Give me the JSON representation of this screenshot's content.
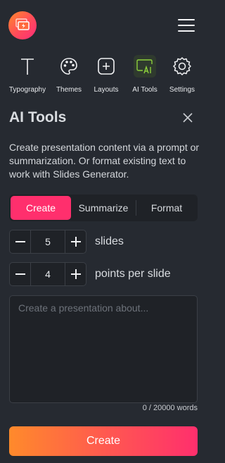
{
  "header": {
    "logo_icon": "slides-logo-icon",
    "menu_icon": "hamburger-menu-icon"
  },
  "tools": [
    {
      "label": "Typography",
      "icon": "text-t-icon"
    },
    {
      "label": "Themes",
      "icon": "palette-icon"
    },
    {
      "label": "Layouts",
      "icon": "add-square-icon"
    },
    {
      "label": "AI Tools",
      "icon": "ai-icon",
      "active": true
    },
    {
      "label": "Settings",
      "icon": "gear-icon"
    }
  ],
  "panel": {
    "title": "AI Tools",
    "description": "Create presentation content via a prompt or summarization. Or format existing text to work with Slides Generator.",
    "tabs": [
      {
        "label": "Create",
        "active": true
      },
      {
        "label": "Summarize"
      },
      {
        "label": "Format"
      }
    ],
    "slides": {
      "value": "5",
      "label": "slides"
    },
    "points": {
      "value": "4",
      "label": "points per slide"
    },
    "prompt_placeholder": "Create a presentation about...",
    "word_count": "0 / 20000 words",
    "create_button": "Create"
  },
  "colors": {
    "accent": "#ff2f6d",
    "gradient_start": "#ff8a2b",
    "background": "#262a31",
    "ai_icon": "#8ccf3c"
  }
}
